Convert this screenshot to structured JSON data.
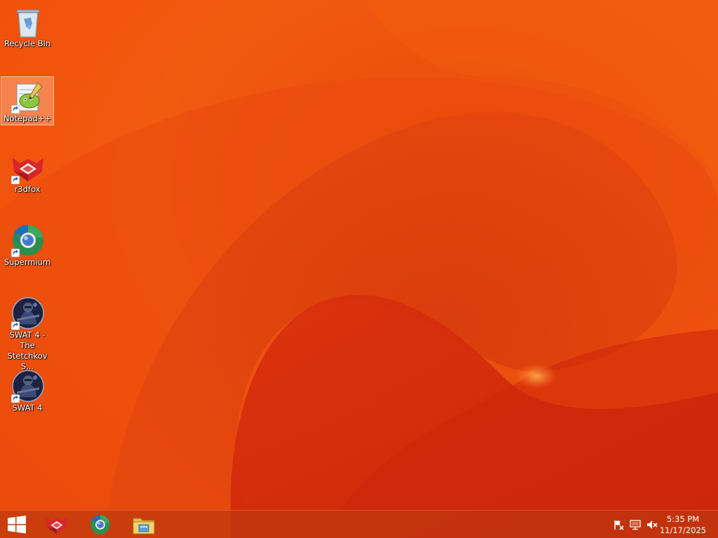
{
  "desktop": {
    "icons": [
      {
        "label": "Recycle Bin",
        "icon": "recycle-bin-icon"
      },
      {
        "label": "Notepad++",
        "icon": "notepad-plus-plus-icon"
      },
      {
        "label": "r3dfox",
        "icon": "r3dfox-icon"
      },
      {
        "label": "Supermium",
        "icon": "supermium-icon"
      },
      {
        "label": "SWAT 4 - The Stetchkov S...",
        "icon": "swat4-icon"
      },
      {
        "label": "SWAT 4",
        "icon": "swat4-icon"
      }
    ],
    "selected_icon": "Notepad++"
  },
  "taskbar": {
    "start_icon": "windows-logo-icon",
    "pinned": [
      {
        "name": "r3dfox",
        "icon": "r3dfox-icon"
      },
      {
        "name": "Supermium",
        "icon": "supermium-icon"
      },
      {
        "name": "File Explorer",
        "icon": "file-explorer-icon"
      }
    ],
    "tray_icons": [
      "action-center-flag-icon",
      "network-icon",
      "volume-muted-icon"
    ],
    "clock": {
      "time": "5:35 PM",
      "date": "11/17/2025"
    }
  },
  "colors": {
    "wallpaper_base": "#ee4a08",
    "wallpaper_dark": "#c8230a",
    "wallpaper_light": "#ff7a2a"
  }
}
